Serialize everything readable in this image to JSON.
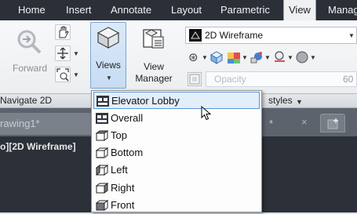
{
  "ribbon_tabs": [
    {
      "label": "Home"
    },
    {
      "label": "Insert"
    },
    {
      "label": "Annotate"
    },
    {
      "label": "Layout"
    },
    {
      "label": "Parametric"
    },
    {
      "label": "View",
      "active": true
    },
    {
      "label": "Manag"
    }
  ],
  "navigate_panel": {
    "forward_label": "Forward",
    "panel_title": "Navigate 2D"
  },
  "views_panel": {
    "views_label": "Views",
    "view_manager_label_line1": "View",
    "view_manager_label_line2": "Manager"
  },
  "visual_styles_panel": {
    "style_value": "2D Wireframe",
    "opacity_placeholder": "Opacity",
    "opacity_value": "60",
    "panel_title": "styles"
  },
  "document": {
    "tab_label": "rawing1*",
    "viewport_label": "o][2D Wireframe]"
  },
  "views_menu": {
    "items": [
      {
        "label": "Elevator Lobby",
        "icon": "named-view-icon",
        "selected": true
      },
      {
        "label": "Overall",
        "icon": "named-view-icon"
      },
      {
        "label": "Top",
        "icon": "top-view-cube-icon"
      },
      {
        "label": "Bottom",
        "icon": "bottom-view-cube-icon"
      },
      {
        "label": "Left",
        "icon": "left-view-cube-icon"
      },
      {
        "label": "Right",
        "icon": "right-view-cube-icon"
      },
      {
        "label": "Front",
        "icon": "front-view-cube-icon"
      }
    ]
  },
  "colors": {
    "tabbar_bg": "#2b2f38",
    "selection_border": "#5b95d4",
    "selection_bg": "#e3eefb",
    "views_button_bg": "#c6dcf3"
  }
}
